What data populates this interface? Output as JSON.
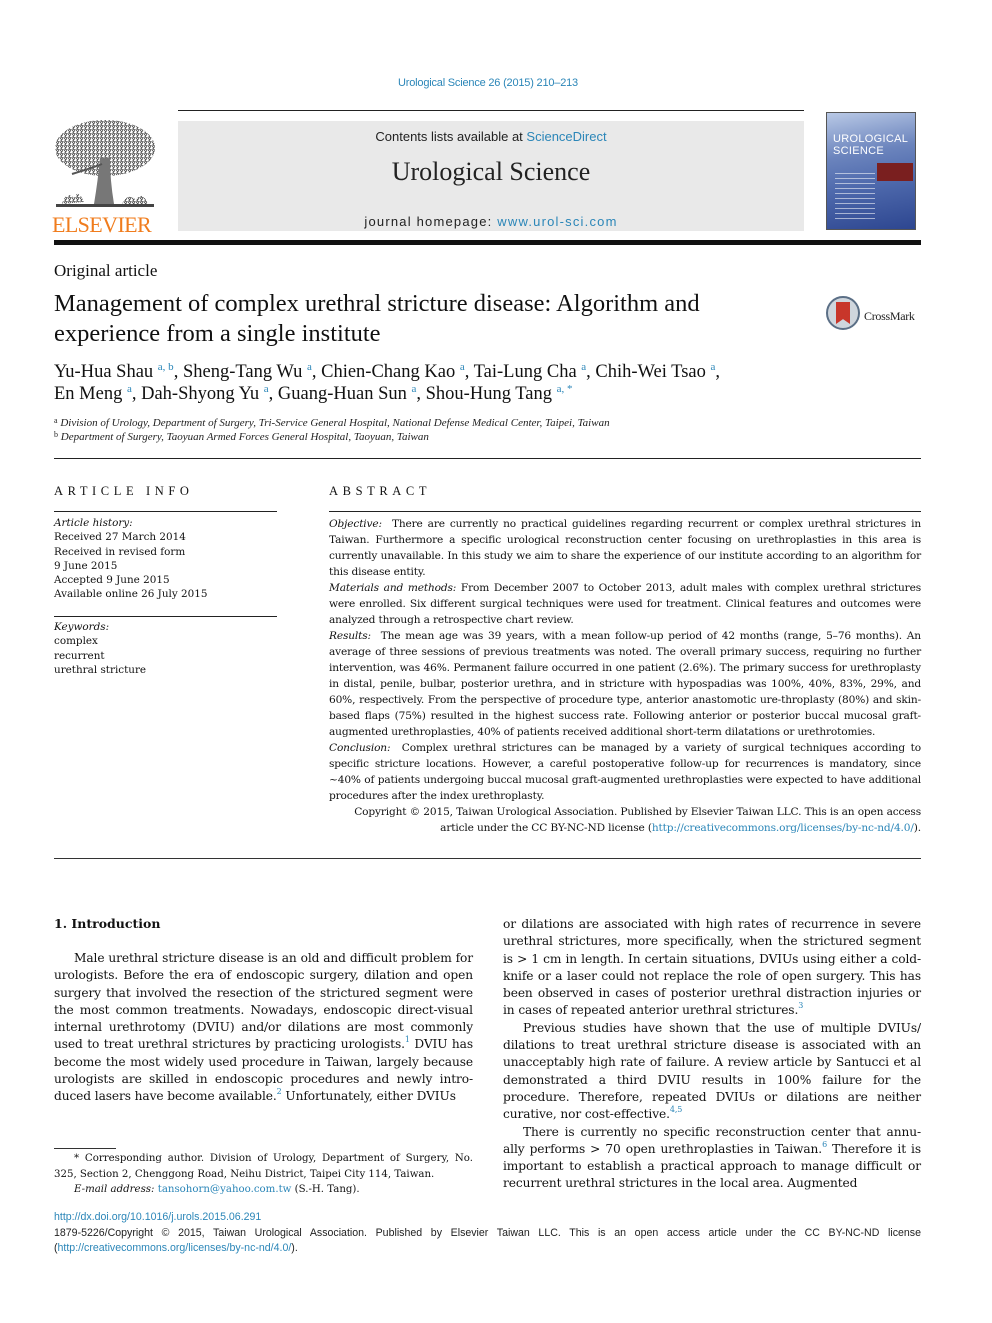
{
  "header": {
    "citation": "Urological Science 26 (2015) 210–213",
    "publisher_logo_text": "ELSEVIER",
    "contents_prefix": "Contents lists available at ",
    "contents_link": "ScienceDirect",
    "journal_title": "Urological Science",
    "homepage_prefix": "journal homepage: ",
    "homepage_link": "www.urol-sci.com",
    "cover_title_line1": "UROLOGICAL",
    "cover_title_line2": "SCIENCE",
    "crossmark_label": "CrossMark"
  },
  "article": {
    "type": "Original article",
    "title": "Management of complex urethral stricture disease: Algorithm and experience from a single institute",
    "authors": [
      {
        "name": "Yu-Hua Shau",
        "aff": "a, b"
      },
      {
        "name": "Sheng-Tang Wu",
        "aff": "a"
      },
      {
        "name": "Chien-Chang Kao",
        "aff": "a"
      },
      {
        "name": "Tai-Lung Cha",
        "aff": "a"
      },
      {
        "name": "Chih-Wei Tsao",
        "aff": "a"
      },
      {
        "name": "En Meng",
        "aff": "a"
      },
      {
        "name": "Dah-Shyong Yu",
        "aff": "a"
      },
      {
        "name": "Guang-Huan Sun",
        "aff": "a"
      },
      {
        "name": "Shou-Hung Tang",
        "aff": "a, *"
      }
    ],
    "affiliations": [
      {
        "mark": "a",
        "text": "Division of Urology, Department of Surgery, Tri-Service General Hospital, National Defense Medical Center, Taipei, Taiwan"
      },
      {
        "mark": "b",
        "text": "Department of Surgery, Taoyuan Armed Forces General Hospital, Taoyuan, Taiwan"
      }
    ]
  },
  "article_info": {
    "heading": "ARTICLE INFO",
    "history_label": "Article history:",
    "history": [
      "Received 27 March 2014",
      "Received in revised form",
      "9 June 2015",
      "Accepted 9 June 2015",
      "Available online 26 July 2015"
    ],
    "keywords_label": "Keywords:",
    "keywords": [
      "complex",
      "recurrent",
      "urethral stricture"
    ]
  },
  "abstract": {
    "heading": "ABSTRACT",
    "sections": [
      {
        "label": "Objective:",
        "text": "There are currently no practical guidelines regarding recurrent or complex urethral strictures in Taiwan. Furthermore a specific urological reconstruction center focusing on urethroplasties in this area is currently unavailable. In this study we aim to share the experience of our institute according to an algorithm for this disease entity."
      },
      {
        "label": "Materials and methods:",
        "text": "From December 2007 to October 2013, adult males with complex urethral strictures were enrolled. Six different surgical techniques were used for treatment. Clinical features and outcomes were analyzed through a retrospective chart review."
      },
      {
        "label": "Results:",
        "text": "The mean age was 39 years, with a mean follow-up period of 42 months (range, 5–76 months). An average of three sessions of previous treatments was noted. The overall primary success, requiring no further intervention, was 46%. Permanent failure occurred in one patient (2.6%). The primary success for urethroplasty in distal, penile, bulbar, posterior urethra, and in stricture with hypospadias was 100%, 40%, 83%, 29%, and 60%, respectively. From the perspective of procedure type, anterior anastomotic ure-throplasty (80%) and skin-based flaps (75%) resulted in the highest success rate. Following anterior or posterior buccal mucosal graft-augmented urethroplasties, 40% of patients received additional short-term dilatations or urethrotomies."
      },
      {
        "label": "Conclusion:",
        "text": "Complex urethral strictures can be managed by a variety of surgical techniques according to specific stricture locations. However, a careful postoperative follow-up for recurrences is mandatory, since ~40% of patients undergoing buccal mucosal graft-augmented urethroplasties were expected to have additional procedures after the index urethroplasty."
      }
    ],
    "copyright_text": "Copyright © 2015, Taiwan Urological Association. Published by Elsevier Taiwan LLC. This is an open access article under the CC BY-NC-ND license (",
    "copyright_link": "http://creativecommons.org/licenses/by-nc-nd/4.0/",
    "copyright_end": ")."
  },
  "body": {
    "section_heading": "1.  Introduction",
    "left_paragraphs": [
      {
        "parts": [
          {
            "t": "Male urethral stricture disease is an old and difficult problem for urologists. Before the era of endoscopic surgery, dilation and open surgery that involved the resection of the strictured segment were the most common treatments. Nowadays, endoscopic direct-visual internal urethrotomy (DVIU) and/or dilations are most commonly used to treat urethral strictures by practicing urologists."
          },
          {
            "ref": "1"
          },
          {
            "t": " DVIU has become the most widely used procedure in Taiwan, largely because urologists are skilled in endoscopic procedures and newly intro-duced lasers have become available."
          },
          {
            "ref": "2"
          },
          {
            "t": " Unfortunately, either DVIUs"
          }
        ]
      }
    ],
    "right_paragraphs": [
      {
        "indent": false,
        "parts": [
          {
            "t": "or dilations are associated with high rates of recurrence in severe urethral strictures, more specifically, when the strictured segment is > 1 cm in length. In certain situations, DVIUs using either a cold-knife or a laser could not replace the role of open surgery. This has been observed in cases of posterior urethral distraction injuries or in cases of repeated anterior urethral strictures."
          },
          {
            "ref": "3"
          }
        ]
      },
      {
        "indent": true,
        "parts": [
          {
            "t": "Previous studies have shown that the use of multiple DVIUs/ dilations to treat urethral stricture disease is associated with an unacceptably high rate of failure. A review article by Santucci et al demonstrated a third DVIU results in 100% failure for the procedure. Therefore, repeated DVIUs or dilations are neither curative, nor cost-effective."
          },
          {
            "ref": "4,5"
          }
        ]
      },
      {
        "indent": true,
        "parts": [
          {
            "t": "There is currently no specific reconstruction center that annu-ally performs > 70 open urethroplasties in Taiwan."
          },
          {
            "ref": "6"
          },
          {
            "t": " Therefore it is important to establish a practical approach to manage difficult or recurrent urethral strictures in the local area. Augmented"
          }
        ]
      }
    ]
  },
  "footnote": {
    "corresponding": "* Corresponding author. Division of Urology, Department of Surgery, No. 325, Section 2, Chenggong Road, Neihu District, Taipei City 114, Taiwan.",
    "email_label": "E-mail address:",
    "email": "tansohorn@yahoo.com.tw",
    "email_suffix": " (S.-H. Tang)."
  },
  "footer": {
    "doi": "http://dx.doi.org/10.1016/j.urols.2015.06.291",
    "issn_text": "1879-5226/Copyright © 2015, Taiwan Urological Association. Published by Elsevier Taiwan LLC. This is an open access article under the CC BY-NC-ND license (",
    "issn_link": "http://creativecommons.org/licenses/by-nc-nd/4.0/",
    "issn_end": ")."
  },
  "colors": {
    "link": "#2b86b8",
    "elsevier_orange": "#f07c1d",
    "masthead_bg": "#e9e9e9"
  }
}
